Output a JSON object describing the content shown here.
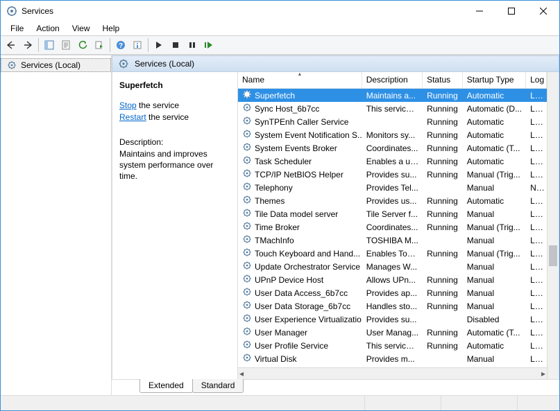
{
  "window": {
    "title": "Services"
  },
  "menu": {
    "file": "File",
    "action": "Action",
    "view": "View",
    "help": "Help"
  },
  "tree": {
    "root": "Services (Local)"
  },
  "pane_header": "Services (Local)",
  "selected_service": {
    "name": "Superfetch",
    "stop_label": "Stop",
    "stop_suffix": " the service",
    "restart_label": "Restart",
    "restart_suffix": " the service",
    "desc_label": "Description:",
    "desc_text": "Maintains and improves system performance over time."
  },
  "columns": {
    "name": "Name",
    "description": "Description",
    "status": "Status",
    "startup": "Startup Type",
    "logon": "Log"
  },
  "tabs": {
    "extended": "Extended",
    "standard": "Standard"
  },
  "services": [
    {
      "name": "Superfetch",
      "desc": "Maintains a...",
      "status": "Running",
      "startup": "Automatic",
      "logon": "Loc",
      "selected": true
    },
    {
      "name": "Sync Host_6b7cc",
      "desc": "This service ...",
      "status": "Running",
      "startup": "Automatic (D...",
      "logon": "Loc"
    },
    {
      "name": "SynTPEnh Caller Service",
      "desc": "",
      "status": "Running",
      "startup": "Automatic",
      "logon": "Loc"
    },
    {
      "name": "System Event Notification S...",
      "desc": "Monitors sy...",
      "status": "Running",
      "startup": "Automatic",
      "logon": "Loc"
    },
    {
      "name": "System Events Broker",
      "desc": "Coordinates...",
      "status": "Running",
      "startup": "Automatic (T...",
      "logon": "Loc"
    },
    {
      "name": "Task Scheduler",
      "desc": "Enables a us...",
      "status": "Running",
      "startup": "Automatic",
      "logon": "Loc"
    },
    {
      "name": "TCP/IP NetBIOS Helper",
      "desc": "Provides su...",
      "status": "Running",
      "startup": "Manual (Trig...",
      "logon": "Loc"
    },
    {
      "name": "Telephony",
      "desc": "Provides Tel...",
      "status": "",
      "startup": "Manual",
      "logon": "Net"
    },
    {
      "name": "Themes",
      "desc": "Provides us...",
      "status": "Running",
      "startup": "Automatic",
      "logon": "Loc"
    },
    {
      "name": "Tile Data model server",
      "desc": "Tile Server f...",
      "status": "Running",
      "startup": "Manual",
      "logon": "Loc"
    },
    {
      "name": "Time Broker",
      "desc": "Coordinates...",
      "status": "Running",
      "startup": "Manual (Trig...",
      "logon": "Loc"
    },
    {
      "name": "TMachInfo",
      "desc": "TOSHIBA M...",
      "status": "",
      "startup": "Manual",
      "logon": "Loc"
    },
    {
      "name": "Touch Keyboard and Hand...",
      "desc": "Enables Tou...",
      "status": "Running",
      "startup": "Manual (Trig...",
      "logon": "Loc"
    },
    {
      "name": "Update Orchestrator Service",
      "desc": "Manages W...",
      "status": "",
      "startup": "Manual",
      "logon": "Loc"
    },
    {
      "name": "UPnP Device Host",
      "desc": "Allows UPn...",
      "status": "Running",
      "startup": "Manual",
      "logon": "Loc"
    },
    {
      "name": "User Data Access_6b7cc",
      "desc": "Provides ap...",
      "status": "Running",
      "startup": "Manual",
      "logon": "Loc"
    },
    {
      "name": "User Data Storage_6b7cc",
      "desc": "Handles sto...",
      "status": "Running",
      "startup": "Manual",
      "logon": "Loc"
    },
    {
      "name": "User Experience Virtualizatio...",
      "desc": "Provides su...",
      "status": "",
      "startup": "Disabled",
      "logon": "Loc"
    },
    {
      "name": "User Manager",
      "desc": "User Manag...",
      "status": "Running",
      "startup": "Automatic (T...",
      "logon": "Loc"
    },
    {
      "name": "User Profile Service",
      "desc": "This service ...",
      "status": "Running",
      "startup": "Automatic",
      "logon": "Loc"
    },
    {
      "name": "Virtual Disk",
      "desc": "Provides m...",
      "status": "",
      "startup": "Manual",
      "logon": "Loc"
    }
  ]
}
